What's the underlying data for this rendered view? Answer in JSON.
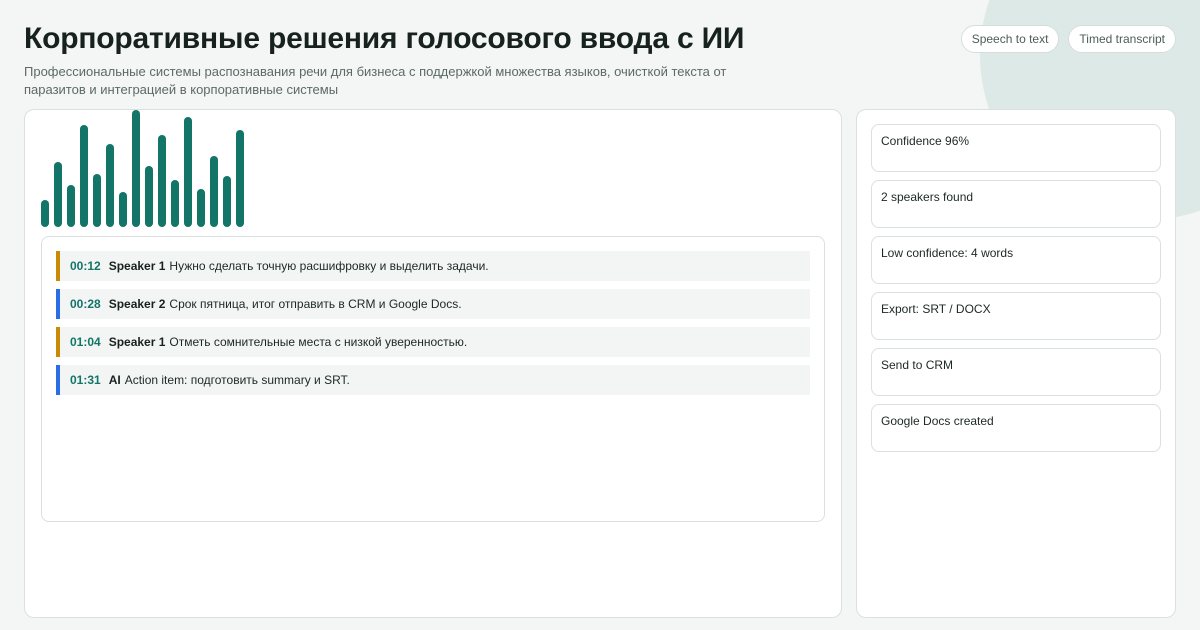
{
  "header": {
    "title": "Корпоративные решения голосового ввода с ИИ",
    "subtitle": "Профессиональные системы распознавания речи для бизнеса с поддержкой множества языков, очисткой текста от паразитов и интеграцией в корпоративные системы",
    "tags": [
      "Speech to text",
      "Timed transcript"
    ]
  },
  "waveform": {
    "levels": [
      0.27,
      0.64,
      0.41,
      1.0,
      0.52,
      0.82,
      0.34,
      1.15,
      0.6,
      0.9,
      0.46,
      1.08,
      0.37,
      0.7,
      0.5,
      0.95
    ],
    "color": "#137468"
  },
  "transcript": {
    "lines": [
      {
        "time": "00:12",
        "speaker": "Speaker 1",
        "text": "Нужно сделать точную расшифровку и выделить задачи.",
        "accent": "#c98a06"
      },
      {
        "time": "00:28",
        "speaker": "Speaker 2",
        "text": "Срок пятница, итог отправить в CRM и Google Docs.",
        "accent": "#2a6ee6"
      },
      {
        "time": "01:04",
        "speaker": "Speaker 1",
        "text": "Отметь сомнительные места с низкой уверенностью.",
        "accent": "#c98a06"
      },
      {
        "time": "01:31",
        "speaker": "AI",
        "text": "Action item: подготовить summary и SRT.",
        "accent": "#2a6ee6"
      }
    ]
  },
  "sidebar": {
    "cards": [
      "Confidence 96%",
      "2 speakers found",
      "Low confidence: 4 words",
      "Export: SRT / DOCX",
      "Send to CRM",
      "Google Docs created"
    ]
  }
}
